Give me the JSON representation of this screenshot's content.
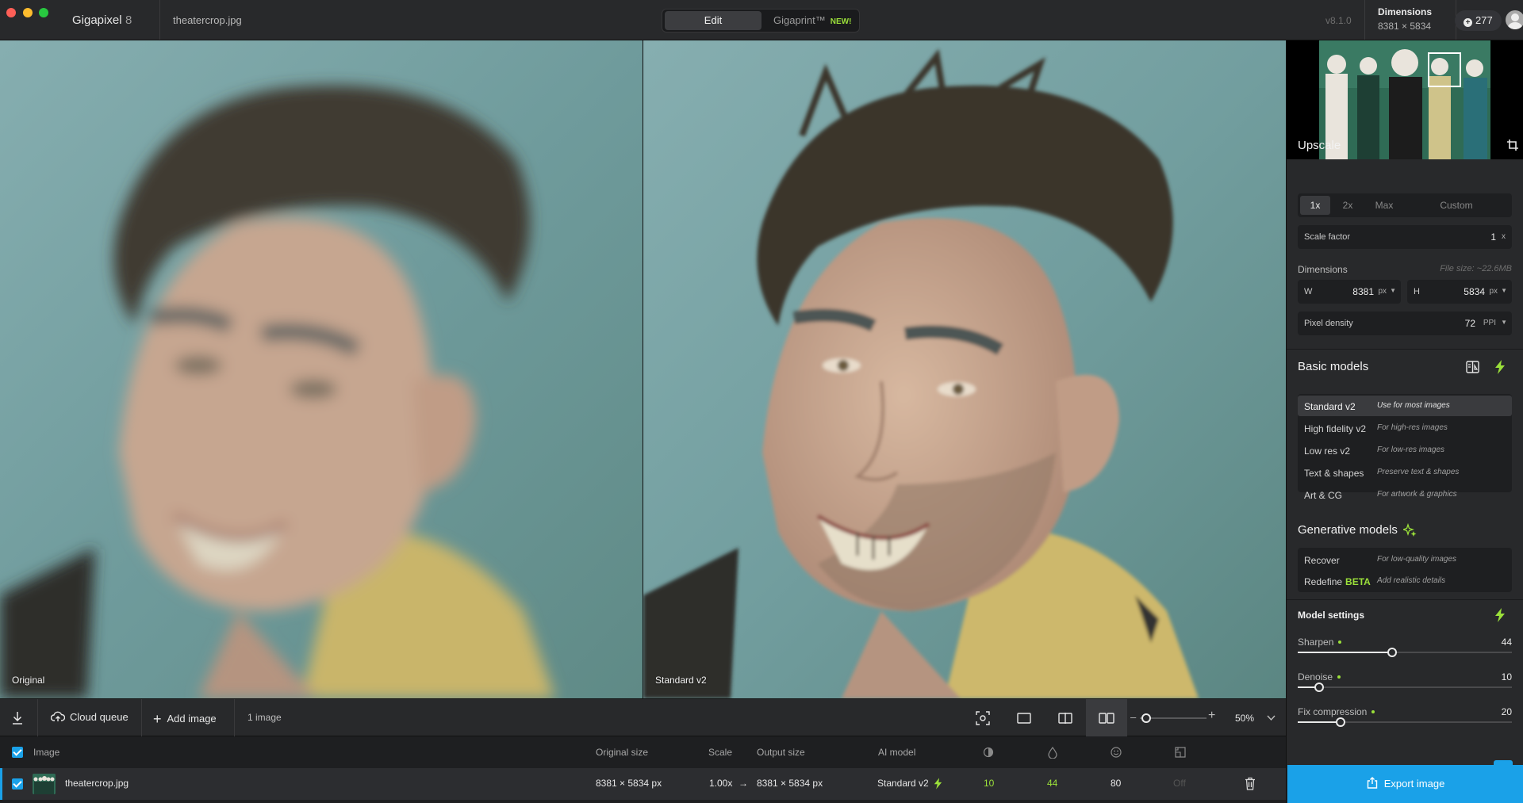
{
  "titlebar": {
    "app_name": "Gigapixel",
    "app_version": "8",
    "file_name": "theatercrop.jpg",
    "mode_edit": "Edit",
    "mode_print": "Gigaprint™",
    "mode_print_badge": "NEW!",
    "version": "v8.1.0",
    "dimensions_title": "Dimensions",
    "dimensions_value": "8381 × 5834",
    "credits": "277"
  },
  "viewer": {
    "left_label": "Original",
    "right_label": "Standard v2"
  },
  "panel": {
    "upscale_title": "Upscale",
    "scale_options": [
      "1x",
      "2x",
      "Max",
      "Custom"
    ],
    "scale_selected": "1x",
    "scale_factor_label": "Scale factor",
    "scale_factor_value": "1",
    "scale_factor_unit": "x",
    "dimensions_label": "Dimensions",
    "file_size": "File size: ~22.6MB",
    "width_label": "W",
    "width_value": "8381",
    "width_unit": "px",
    "height_label": "H",
    "height_value": "5834",
    "height_unit": "px",
    "pixel_density_label": "Pixel density",
    "pixel_density_value": "72",
    "pixel_density_unit": "PPI",
    "basic_models_title": "Basic models",
    "basic_models": [
      {
        "name": "Standard v2",
        "desc": "Use for most images",
        "selected": true
      },
      {
        "name": "High fidelity v2",
        "desc": "For high-res images",
        "selected": false
      },
      {
        "name": "Low res v2",
        "desc": "For low-res images",
        "selected": false
      },
      {
        "name": "Text & shapes",
        "desc": "Preserve text & shapes",
        "selected": false
      },
      {
        "name": "Art & CG",
        "desc": "For artwork & graphics",
        "selected": false
      }
    ],
    "generative_models_title": "Generative models",
    "generative_models": [
      {
        "name": "Recover",
        "desc": "For low-quality images"
      },
      {
        "name": "Redefine",
        "badge": "BETA",
        "desc": "Add realistic details"
      }
    ],
    "model_settings_title": "Model settings",
    "sliders": [
      {
        "label": "Sharpen",
        "value": "44",
        "fraction": 0.44
      },
      {
        "label": "Denoise",
        "value": "10",
        "fraction": 0.1
      },
      {
        "label": "Fix compression",
        "value": "20",
        "fraction": 0.2
      }
    ],
    "export_label": "Export image"
  },
  "toolbar": {
    "cloud_queue": "Cloud queue",
    "add_image": "Add image",
    "image_count": "1 image",
    "zoom": "50%",
    "zoom_fraction": 0.1
  },
  "table": {
    "headers": {
      "image": "Image",
      "original_size": "Original size",
      "scale": "Scale",
      "output_size": "Output size",
      "ai_model": "AI model"
    },
    "row": {
      "name": "theatercrop.jpg",
      "original_size": "8381 × 5834 px",
      "scale": "1.00x",
      "arrow": "→",
      "output_size": "8381 × 5834 px",
      "ai_model": "Standard v2",
      "denoise": "10",
      "sharpen": "44",
      "face": "80",
      "compression": "Off"
    }
  },
  "colors": {
    "accent_blue": "#1aa1e8",
    "accent_green": "#9be03a",
    "panel_bg": "#28292b",
    "field_bg": "#1e1f21"
  }
}
